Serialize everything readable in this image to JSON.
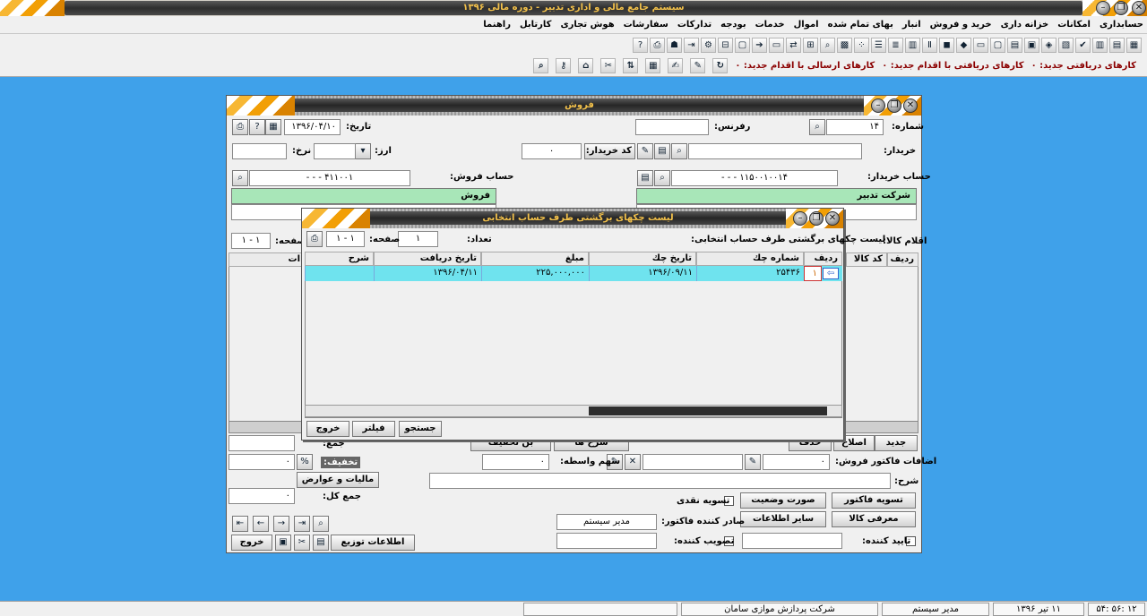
{
  "app": {
    "title": "سیستم جامع مالی و اداری تدبیر - دوره مالی ۱۳۹۶"
  },
  "menu": [
    "حسابداری",
    "امکانات",
    "خزانه داری",
    "خرید و فروش",
    "انبار",
    "بهای تمام شده",
    "اموال",
    "خدمات",
    "بودجه",
    "تداركات",
    "سفارشات",
    "هوش تجاری",
    "كارتابل",
    "راهنما"
  ],
  "notifications": {
    "received_new": "كارهای دریافتی جدید: ۰",
    "received_action": "كارهای دریافتی با اقدام جدید: ۰",
    "sent_action": "كارهای ارسالی با اقدام جدید: ۰"
  },
  "sale_window": {
    "title": "فروش",
    "number_label": "شماره:",
    "number_value": "۱۴",
    "ref_label": "رفرنس:",
    "ref_value": "",
    "date_label": "تاریخ:",
    "date_value": "۱۳۹۶/۰۴/۱۰",
    "buyer_label": "خریدار:",
    "buyer_value": "",
    "buyer_code_button": "كد خریدار:",
    "buyer_code_value": "۰",
    "currency_label": "ارز:",
    "rate_label": "نرخ:",
    "buyer_account_label": "حساب خریدار:",
    "buyer_account_value": "۱۱۵۰۰۱۰۰۱۴ - - -",
    "sale_account_label": "حساب فروش:",
    "sale_account_value": "۴۱۱۰۰۱ - - -",
    "buyer_account_name": "شركت تدبیر",
    "sale_account_name": "فروش",
    "items_label": "اقلام كالا:",
    "page_label": "صفحه:",
    "page_value": "۱ - ۱",
    "col_row": "ردیف",
    "col_code": "كد كالا",
    "col_cut": "ات",
    "btn_new": "جدید",
    "btn_edit": "اصلاح",
    "btn_delete": "حذف",
    "btn_details": "شرح ها",
    "btn_per_item": "بن تخفیف",
    "sum_label": "جمع:",
    "invoice_additions_label": "اضافات فاكتور فروش:",
    "invoice_additions_value": "۰",
    "share_label": "سهم واسطه:",
    "share_value": "۰",
    "discount_label": "تخفیف:",
    "discount_value": "۰",
    "tax_button": "مالیات و عوارض",
    "desc_label": "شرح:",
    "total_label": "جمع كل:",
    "total_value": "۰",
    "btn_settle_invoice": "تسویه فاكتور",
    "btn_status": "صورت وضعیت",
    "cash_settle_label": "تسویه نقدی",
    "btn_product_intro": "معرفی كالا",
    "btn_other_info": "سایر اطلاعات",
    "issuer_label": "صادر كننده فاكتور:",
    "issuer_value": "مدیر سیستم",
    "approver_label": "تصویب كننده:",
    "confirmer_label": "تایید كننده:",
    "btn_distribution": "اطلاعات توزیع",
    "btn_exit": "خروج"
  },
  "checks_dialog": {
    "title": "لیست چكهای برگشتی طرف حساب انتخابی",
    "subtitle": "لیست چكهای برگشتی طرف حساب انتخابی:",
    "count_label": "تعداد:",
    "count_value": "۱",
    "page_label": "صفحه:",
    "page_value": "۱ - ۱",
    "columns": [
      "ردیف",
      "شماره چك",
      "تاریخ چك",
      "مبلغ",
      "تاریخ دریافت",
      "شرح"
    ],
    "rows": [
      {
        "row": "۱",
        "check_no": "۲۵۴۳۶",
        "check_date": "۱۳۹۶/۰۹/۱۱",
        "amount": "۲۲۵,۰۰۰,۰۰۰",
        "receive_date": "۱۳۹۶/۰۴/۱۱",
        "desc": ""
      }
    ],
    "btn_search": "جستجو",
    "btn_filter": "فیلتر",
    "btn_exit": "خروج"
  },
  "status": {
    "company": "شركت پردازش موازی سامان",
    "user": "مدیر سیستم",
    "date": "۱۱ تیر ۱۳۹۶",
    "time": "۱۲ :۵۶ :۵۴"
  }
}
